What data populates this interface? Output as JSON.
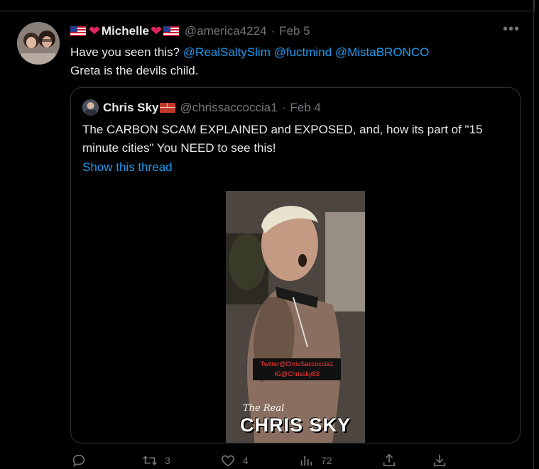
{
  "tweet": {
    "display_name": "Michelle",
    "handle": "@america4224",
    "separator": "·",
    "date": "Feb 5",
    "more_icon": "more-icon",
    "text_intro": "Have you seen this?",
    "mentions": [
      "@RealSaltySlim",
      "@fuctmind",
      "@MistaBRONCO"
    ],
    "text_line2": "Greta is the devils child."
  },
  "quoted": {
    "display_name": "Chris Sky",
    "handle": "@chrissaccoccia1",
    "separator": "·",
    "date": "Feb 4",
    "text": "The CARBON SCAM EXPLAINED and EXPOSED, and, how its part of \"15 minute cities\"  You NEED to see this!",
    "show_thread": "Show this thread",
    "video": {
      "credit_line1": "Twitter@ChrisSaccoccia1",
      "credit_line2": "IG@Chrissky83",
      "brand_small": "The Real",
      "brand_large": "CHRIS SKY"
    }
  },
  "actions": {
    "reply": {
      "icon": "reply-icon",
      "count": ""
    },
    "retweet": {
      "icon": "retweet-icon",
      "count": "3"
    },
    "like": {
      "icon": "heart-icon",
      "count": "4"
    },
    "views": {
      "icon": "views-icon",
      "count": "72"
    },
    "share": {
      "icon": "share-icon",
      "count": ""
    },
    "download": {
      "icon": "download-icon",
      "count": ""
    }
  },
  "colors": {
    "background": "#000000",
    "text": "#e7e9ea",
    "muted": "#71767b",
    "link": "#1d9bf0",
    "border": "#2f3336",
    "heart": "#e0245e"
  }
}
